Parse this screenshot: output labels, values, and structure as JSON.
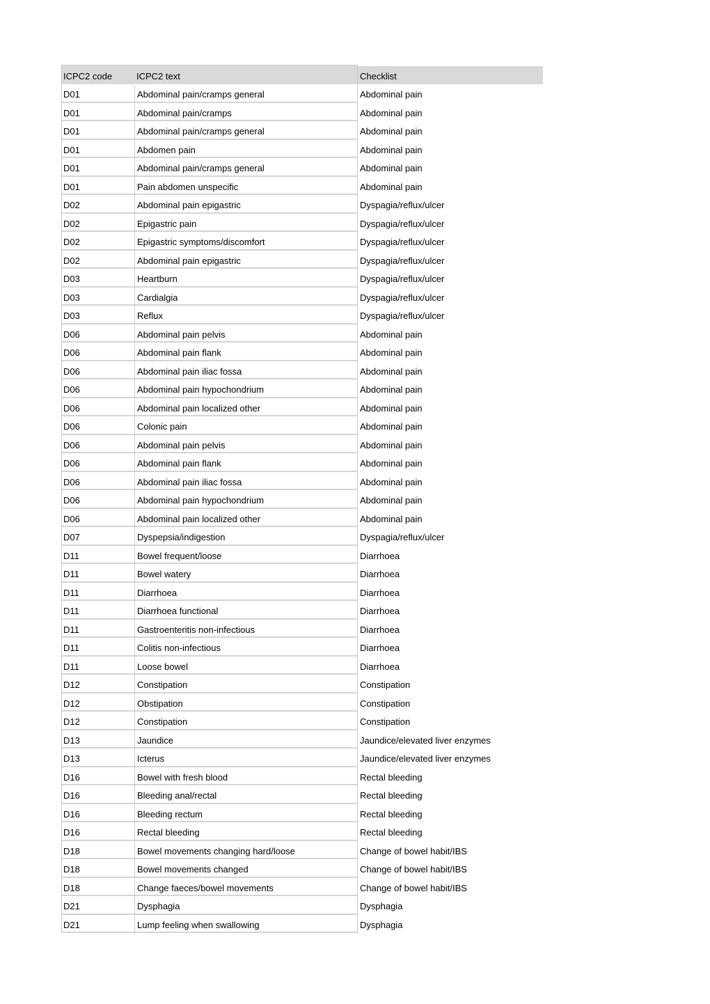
{
  "table": {
    "headers": [
      "ICPC2 code",
      "ICPC2 text",
      "Checklist"
    ],
    "rows": [
      [
        "D01",
        "Abdominal pain/cramps general",
        "Abdominal pain"
      ],
      [
        "D01",
        "Abdominal pain/cramps",
        "Abdominal pain"
      ],
      [
        "D01",
        "Abdominal pain/cramps general",
        "Abdominal pain"
      ],
      [
        "D01",
        "Abdomen pain",
        "Abdominal pain"
      ],
      [
        "D01",
        "Abdominal pain/cramps general",
        "Abdominal pain"
      ],
      [
        "D01",
        "Pain abdomen unspecific",
        "Abdominal pain"
      ],
      [
        "D02",
        "Abdominal pain epigastric",
        "Dyspagia/reflux/ulcer"
      ],
      [
        "D02",
        "Epigastric pain",
        "Dyspagia/reflux/ulcer"
      ],
      [
        "D02",
        "Epigastric symptoms/discomfort",
        "Dyspagia/reflux/ulcer"
      ],
      [
        "D02",
        "Abdominal pain epigastric",
        "Dyspagia/reflux/ulcer"
      ],
      [
        "D03",
        "Heartburn",
        "Dyspagia/reflux/ulcer"
      ],
      [
        "D03",
        "Cardialgia",
        "Dyspagia/reflux/ulcer"
      ],
      [
        "D03",
        "Reflux",
        "Dyspagia/reflux/ulcer"
      ],
      [
        "D06",
        "Abdominal pain pelvis",
        "Abdominal pain"
      ],
      [
        "D06",
        "Abdominal pain flank",
        "Abdominal pain"
      ],
      [
        "D06",
        "Abdominal pain iliac fossa",
        "Abdominal pain"
      ],
      [
        "D06",
        "Abdominal pain hypochondrium",
        "Abdominal pain"
      ],
      [
        "D06",
        "Abdominal pain localized other",
        "Abdominal pain"
      ],
      [
        "D06",
        "Colonic pain",
        "Abdominal pain"
      ],
      [
        "D06",
        "Abdominal pain pelvis",
        "Abdominal pain"
      ],
      [
        "D06",
        "Abdominal pain flank",
        "Abdominal pain"
      ],
      [
        "D06",
        "Abdominal pain iliac fossa",
        "Abdominal pain"
      ],
      [
        "D06",
        "Abdominal pain hypochondrium",
        "Abdominal pain"
      ],
      [
        "D06",
        "Abdominal pain localized other",
        "Abdominal pain"
      ],
      [
        "D07",
        "Dyspepsia/indigestion",
        "Dyspagia/reflux/ulcer"
      ],
      [
        "D11",
        "Bowel frequent/loose",
        "Diarrhoea"
      ],
      [
        "D11",
        "Bowel watery",
        "Diarrhoea"
      ],
      [
        "D11",
        "Diarrhoea",
        "Diarrhoea"
      ],
      [
        "D11",
        "Diarrhoea functional",
        "Diarrhoea"
      ],
      [
        "D11",
        "Gastroenteritis non-infectious",
        "Diarrhoea"
      ],
      [
        "D11",
        "Colitis non-infectious",
        "Diarrhoea"
      ],
      [
        "D11",
        "Loose bowel",
        "Diarrhoea"
      ],
      [
        "D12",
        "Constipation",
        "Constipation"
      ],
      [
        "D12",
        "Obstipation",
        "Constipation"
      ],
      [
        "D12",
        "Constipation",
        "Constipation"
      ],
      [
        "D13",
        "Jaundice",
        "Jaundice/elevated liver enzymes"
      ],
      [
        "D13",
        "Icterus",
        "Jaundice/elevated liver enzymes"
      ],
      [
        "D16",
        "Bowel with fresh blood",
        "Rectal bleeding"
      ],
      [
        "D16",
        "Bleeding anal/rectal",
        "Rectal bleeding"
      ],
      [
        "D16",
        "Bleeding rectum",
        "Rectal bleeding"
      ],
      [
        "D16",
        "Rectal bleeding",
        "Rectal bleeding"
      ],
      [
        "D18",
        "Bowel movements changing hard/loose",
        "Change of bowel habit/IBS"
      ],
      [
        "D18",
        "Bowel movements changed",
        "Change of bowel habit/IBS"
      ],
      [
        "D18",
        "Change faeces/bowel movements",
        "Change of bowel habit/IBS"
      ],
      [
        "D21",
        "Dysphagia",
        "Dysphagia"
      ],
      [
        "D21",
        "Lump feeling when swallowing",
        "Dysphagia"
      ]
    ]
  }
}
